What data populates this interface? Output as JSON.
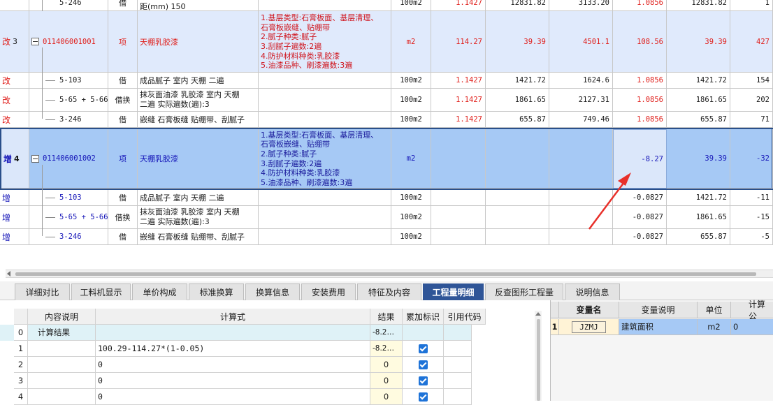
{
  "main_grid": {
    "top_row": {
      "col_a": "5-246",
      "type": "借",
      "name": "距(mm) 150",
      "unit": "100m2",
      "v1": "1.1427",
      "v2": "12831.82",
      "v3": "3133.20",
      "v4": "1.0856",
      "v5": "12831.82",
      "v6": "1"
    },
    "rows": [
      {
        "status": "改",
        "seq": "3",
        "code": "011406001001",
        "type": "项",
        "name": "天棚乳胶漆",
        "features": [
          "1.基层类型:石膏板面、基层清理、",
          "石膏板嵌缝、贴绷带",
          "2.腻子种类:腻子",
          "3.刮腻子遍数:2遍",
          "4.防护材料种类:乳胶漆",
          "5.油漆品种、刷漆遍数:3遍"
        ],
        "unit": "m2",
        "qty": "114.27",
        "price": "39.39",
        "total": "4501.1",
        "new_qty": "108.56",
        "new_price": "39.39",
        "new_total": "427"
      },
      {
        "status": "改",
        "code": "5-103",
        "type": "借",
        "name": "成品腻子 室内 天棚 二遍",
        "unit": "100m2",
        "qty": "1.1427",
        "price": "1421.72",
        "total": "1624.6",
        "new_qty": "1.0856",
        "new_price": "1421.72",
        "new_total": "154"
      },
      {
        "status": "改",
        "code": "5-65 + 5-66",
        "type": "借换",
        "name_lines": [
          "抹灰面油漆 乳胶漆 室内 天棚",
          "二遍  实际遍数(遍):3"
        ],
        "unit": "100m2",
        "qty": "1.1427",
        "price": "1861.65",
        "total": "2127.31",
        "new_qty": "1.0856",
        "new_price": "1861.65",
        "new_total": "202"
      },
      {
        "status": "改",
        "code": "3-246",
        "type": "借",
        "name": "嵌缝 石膏板缝 贴绷带、刮腻子",
        "unit": "100m2",
        "qty": "1.1427",
        "price": "655.87",
        "total": "749.46",
        "new_qty": "1.0856",
        "new_price": "655.87",
        "new_total": "71"
      },
      {
        "status": "增",
        "seq": "4",
        "code": "011406001002",
        "type": "项",
        "name": "天棚乳胶漆",
        "features": [
          "1.基层类型:石膏板面、基层清理、",
          "石膏板嵌缝、贴绷带",
          "2.腻子种类:腻子",
          "3.刮腻子遍数:2遍",
          "4.防护材料种类:乳胶漆",
          "5.油漆品种、刷漆遍数:3遍"
        ],
        "unit": "m2",
        "qty": "",
        "price": "",
        "total": "",
        "new_qty": "-8.27",
        "new_price": "39.39",
        "new_total": "-32"
      },
      {
        "status": "增",
        "code": "5-103",
        "type": "借",
        "name": "成品腻子 室内 天棚 二遍",
        "unit": "100m2",
        "new_qty": "-0.0827",
        "new_price": "1421.72",
        "new_total": "-11"
      },
      {
        "status": "增",
        "code": "5-65 + 5-66",
        "type": "借换",
        "name_lines": [
          "抹灰面油漆 乳胶漆 室内 天棚",
          "二遍  实际遍数(遍):3"
        ],
        "unit": "100m2",
        "new_qty": "-0.0827",
        "new_price": "1861.65",
        "new_total": "-15"
      },
      {
        "status": "增",
        "code": "3-246",
        "type": "借",
        "name": "嵌缝 石膏板缝 贴绷带、刮腻子",
        "unit": "100m2",
        "new_qty": "-0.0827",
        "new_price": "655.87",
        "new_total": "-5"
      }
    ]
  },
  "tabs": [
    "详细对比",
    "工料机显示",
    "单价构成",
    "标准换算",
    "换算信息",
    "安装费用",
    "特征及内容",
    "工程量明细",
    "反查图形工程量",
    "说明信息"
  ],
  "active_tab": "工程量明细",
  "formula_grid": {
    "headers": [
      "内容说明",
      "计算式",
      "结果",
      "累加标识",
      "引用代码"
    ],
    "rows": [
      {
        "index": "0",
        "desc": "计算结果",
        "formula": "",
        "result": "-8.2…",
        "checked": false
      },
      {
        "index": "1",
        "desc": "",
        "formula": "100.29-114.27*(1-0.05)",
        "result": "-8.2…",
        "checked": true
      },
      {
        "index": "2",
        "desc": "",
        "formula": "0",
        "result": "0",
        "checked": true
      },
      {
        "index": "3",
        "desc": "",
        "formula": "0",
        "result": "0",
        "checked": true
      },
      {
        "index": "4",
        "desc": "",
        "formula": "0",
        "result": "0",
        "checked": true
      }
    ]
  },
  "variable_grid": {
    "headers": [
      "变量名",
      "变量说明",
      "单位",
      "计算公"
    ],
    "rows": [
      {
        "index": "1",
        "name": "JZMJ",
        "desc": "建筑面积",
        "unit": "m2",
        "value": "0"
      }
    ]
  },
  "colors": {
    "status_red": "#e0201c",
    "status_blue": "#1515b8",
    "selected_row": "#a6c9f5",
    "highlight_row": "#e0eafc",
    "tab_active": "#2f5597",
    "checkbox": "#1e73d8",
    "arrow": "#e8302a"
  }
}
